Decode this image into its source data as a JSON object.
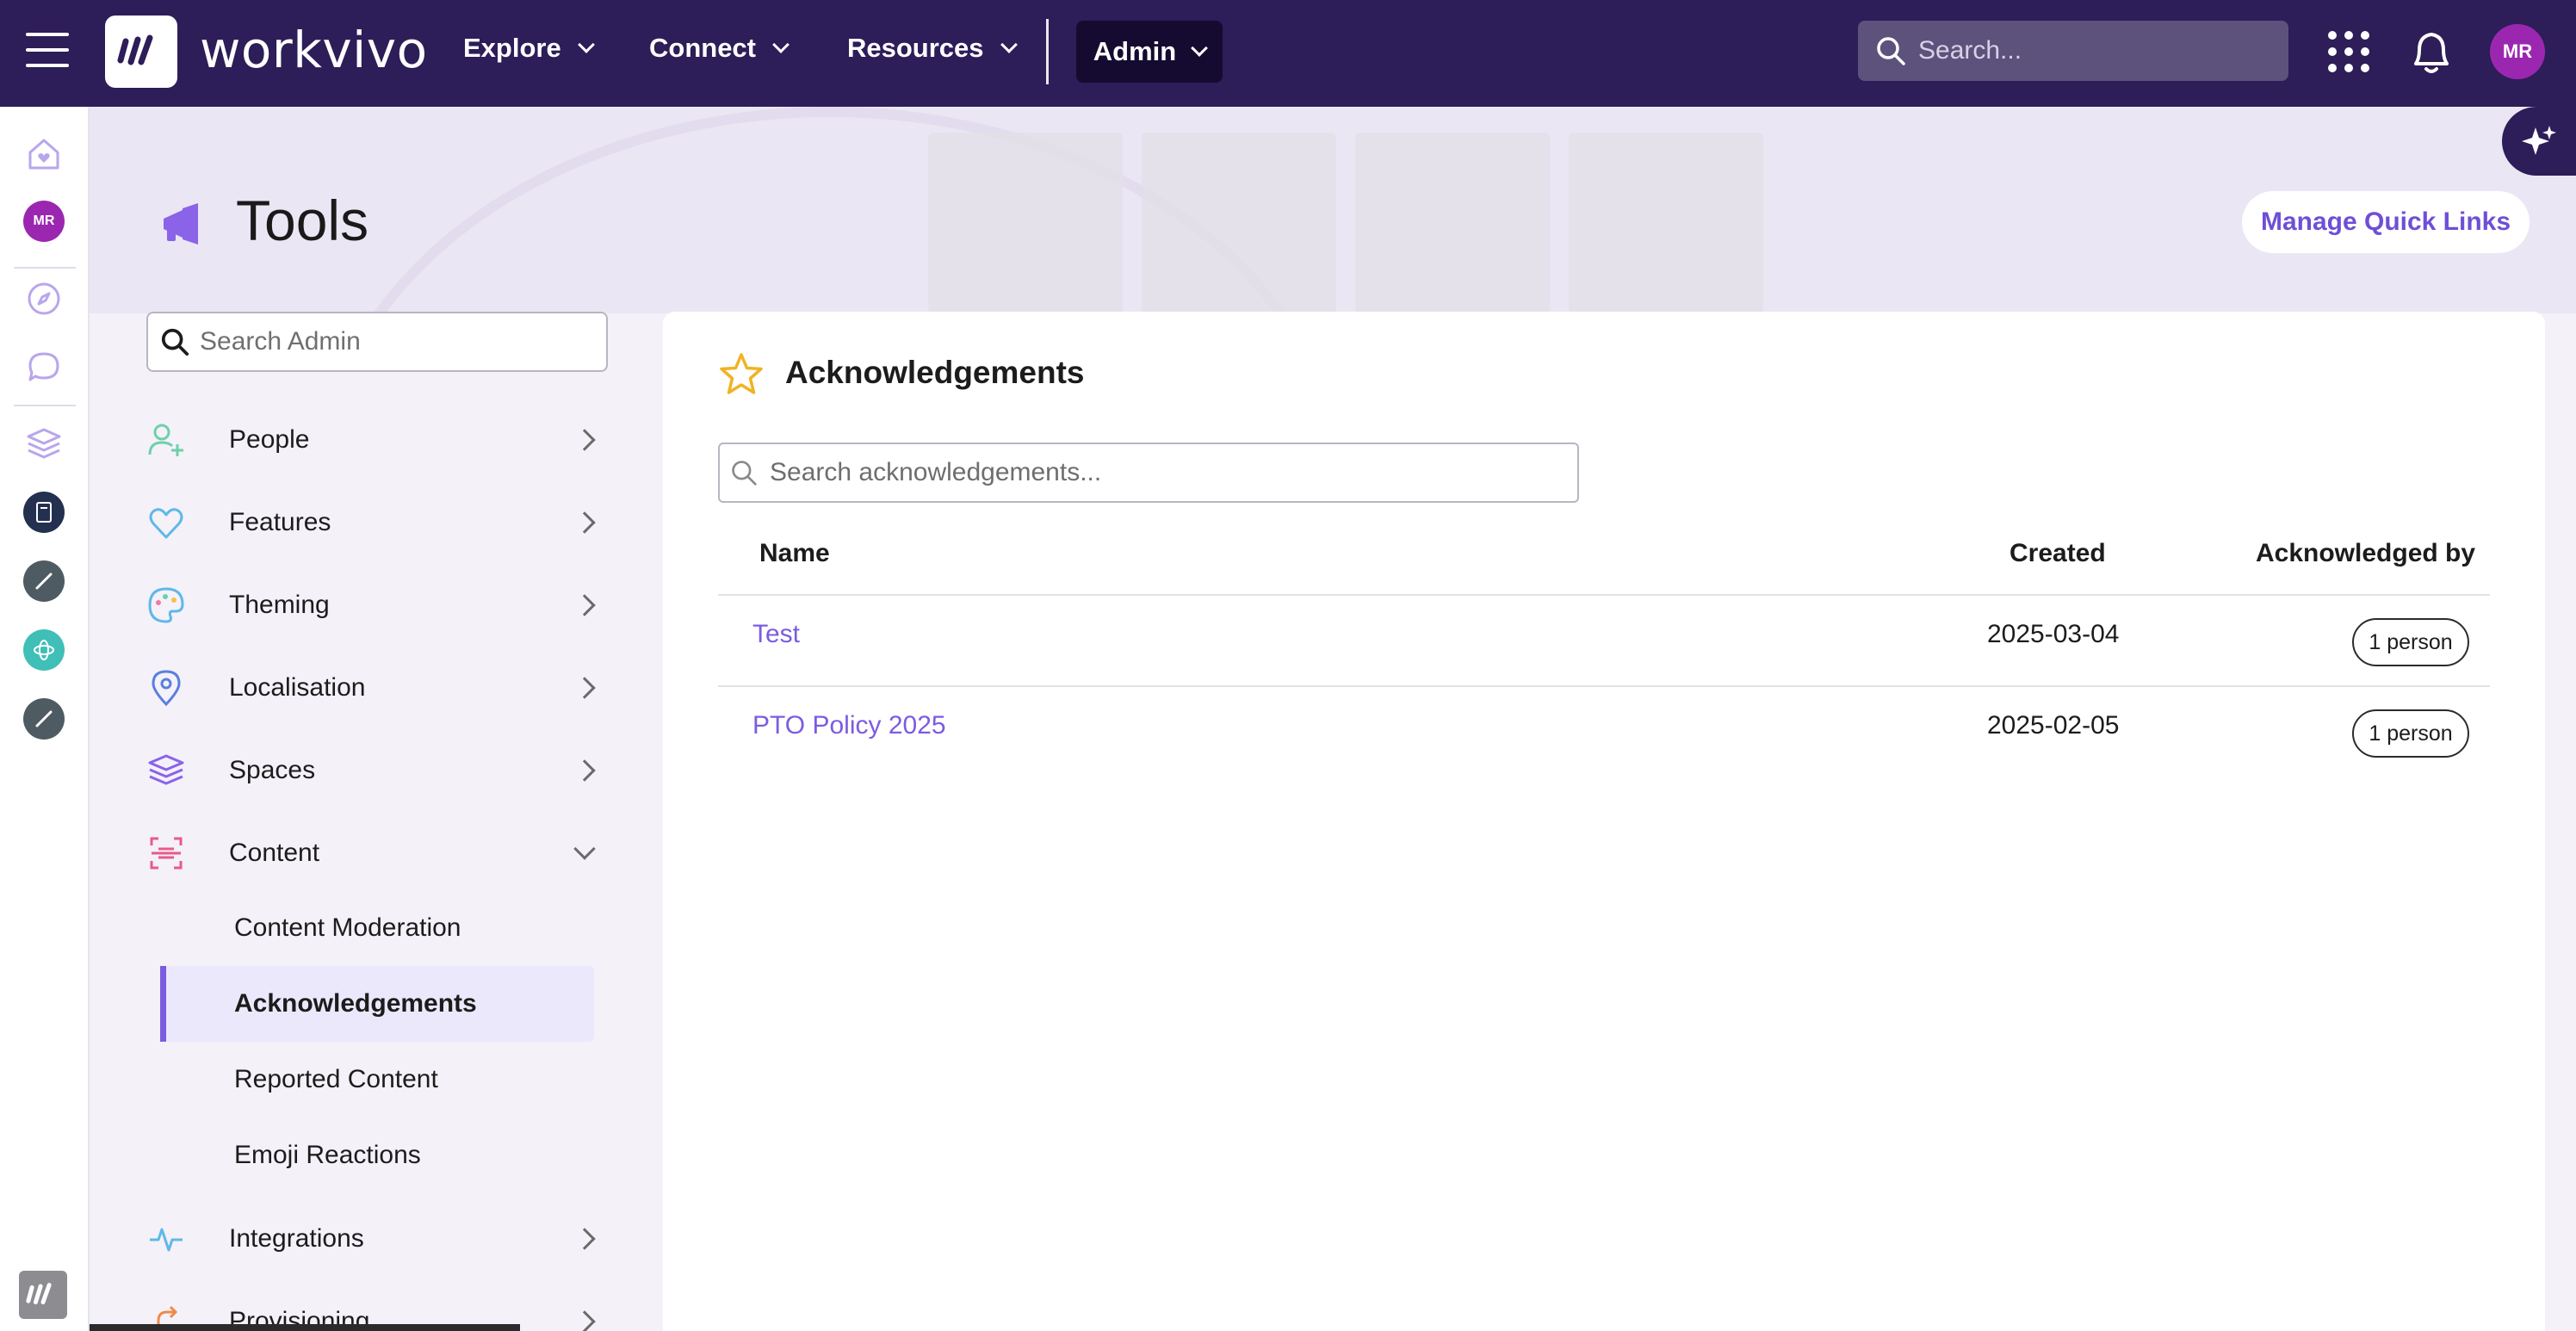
{
  "topbar": {
    "brand": "workvivo",
    "nav": [
      "Explore",
      "Connect",
      "Resources"
    ],
    "admin_label": "Admin",
    "search_placeholder": "Search...",
    "user_initials": "MR"
  },
  "rail": {
    "user_initials": "MR"
  },
  "page": {
    "title": "Tools",
    "manage_quick_links": "Manage Quick Links"
  },
  "sidebar": {
    "search_placeholder": "Search Admin",
    "items": [
      {
        "label": "People",
        "icon": "person-add-icon"
      },
      {
        "label": "Features",
        "icon": "heart-icon"
      },
      {
        "label": "Theming",
        "icon": "palette-icon"
      },
      {
        "label": "Localisation",
        "icon": "map-pin-icon"
      },
      {
        "label": "Spaces",
        "icon": "layers-icon"
      },
      {
        "label": "Content",
        "icon": "scan-icon",
        "expanded": true
      },
      {
        "label": "Integrations",
        "icon": "pulse-icon"
      },
      {
        "label": "Provisioning",
        "icon": "provisioning-icon"
      }
    ],
    "content_sub": [
      "Content Moderation",
      "Acknowledgements",
      "Reported Content",
      "Emoji Reactions"
    ],
    "active_sub": "Acknowledgements"
  },
  "panel": {
    "title": "Acknowledgements",
    "search_placeholder": "Search acknowledgements...",
    "columns": {
      "name": "Name",
      "created": "Created",
      "acknowledged_by": "Acknowledged by"
    },
    "rows": [
      {
        "name": "Test",
        "created": "2025-03-04",
        "acknowledged_by": "1 person"
      },
      {
        "name": "PTO Policy 2025",
        "created": "2025-02-05",
        "acknowledged_by": "1 person"
      }
    ]
  },
  "colors": {
    "topbar": "#2d1d58",
    "accent": "#7b5ce0",
    "avatar": "#9b27b0"
  }
}
